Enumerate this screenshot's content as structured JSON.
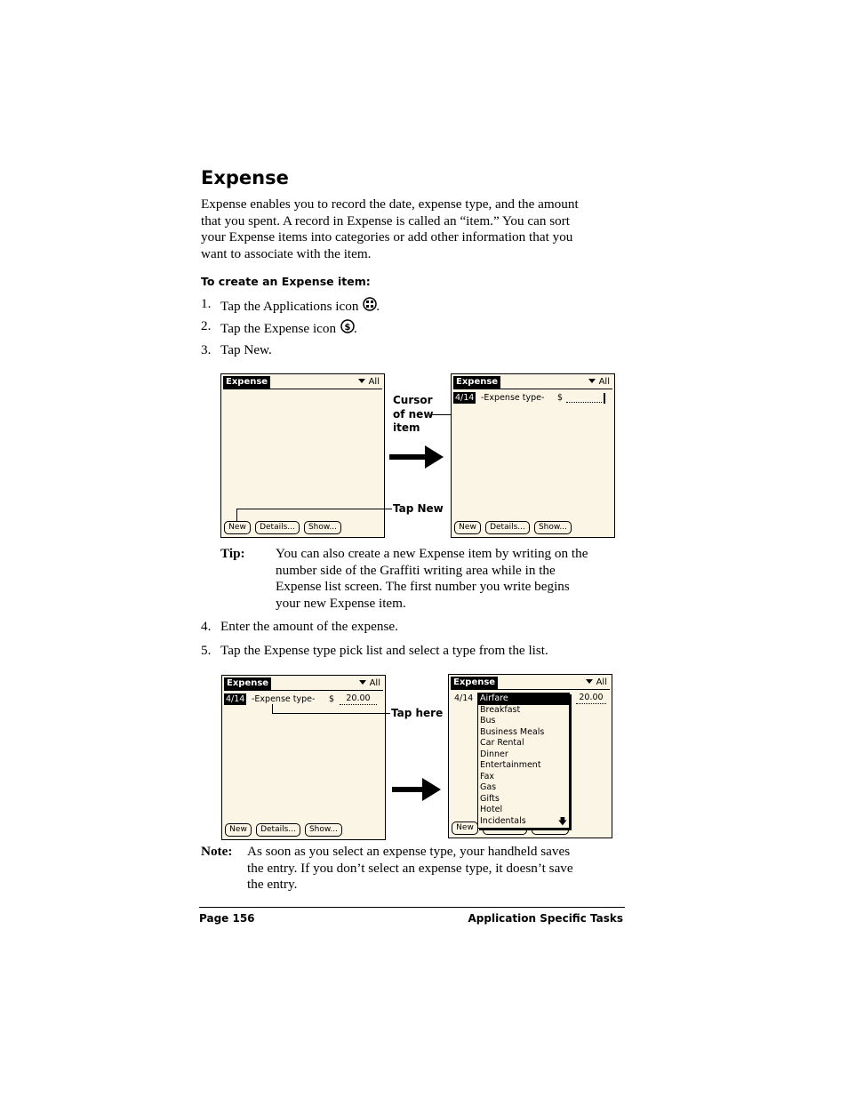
{
  "heading": "Expense",
  "intro_lines": [
    "Expense enables you to record the date, expense type, and the amount",
    "that you spent. A record in Expense is called an “item.” You can sort",
    "your Expense items into categories or add other information that you",
    "want to associate with the item."
  ],
  "subheading": "To create an Expense item:",
  "steps": [
    {
      "num": "1.",
      "text": "Tap the Applications icon",
      "icon": "applications-icon",
      "end": "."
    },
    {
      "num": "2.",
      "text": "Tap the Expense icon",
      "icon": "expense-icon",
      "end": "."
    },
    {
      "num": "3.",
      "text": "Tap New."
    },
    {
      "num": "4.",
      "text": "Enter the amount of the expense."
    },
    {
      "num": "5.",
      "text": "Tap the Expense type pick list and select a type from the list."
    }
  ],
  "screen": {
    "title": "Expense",
    "category": "All",
    "buttons": {
      "new": "New",
      "details": "Details...",
      "show": "Show..."
    },
    "date": "4/14",
    "expense_type": "-Expense type-",
    "currency": "$",
    "amount": "20.00"
  },
  "callouts": {
    "cursor": [
      "Cursor",
      "of new",
      "item"
    ],
    "tap_new": "Tap New",
    "tap_here": "Tap here"
  },
  "tip": {
    "label": "Tip:",
    "lines": [
      "You can also create a new Expense item by writing on the",
      "number side of the Graffiti writing area while in the",
      "Expense list screen. The first number you write begins",
      "your new Expense item."
    ]
  },
  "picklist": [
    "Airfare",
    "Breakfast",
    "Bus",
    "Business Meals",
    "Car Rental",
    "Dinner",
    "Entertainment",
    "Fax",
    "Gas",
    "Gifts",
    "Hotel",
    "Incidentals"
  ],
  "note": {
    "label": "Note:",
    "lines": [
      "As soon as you select an expense type, your handheld saves",
      "the entry. If you don’t select an expense type, it doesn’t save",
      "the entry."
    ]
  },
  "footer": {
    "page": "Page 156",
    "section": "Application Specific Tasks"
  }
}
